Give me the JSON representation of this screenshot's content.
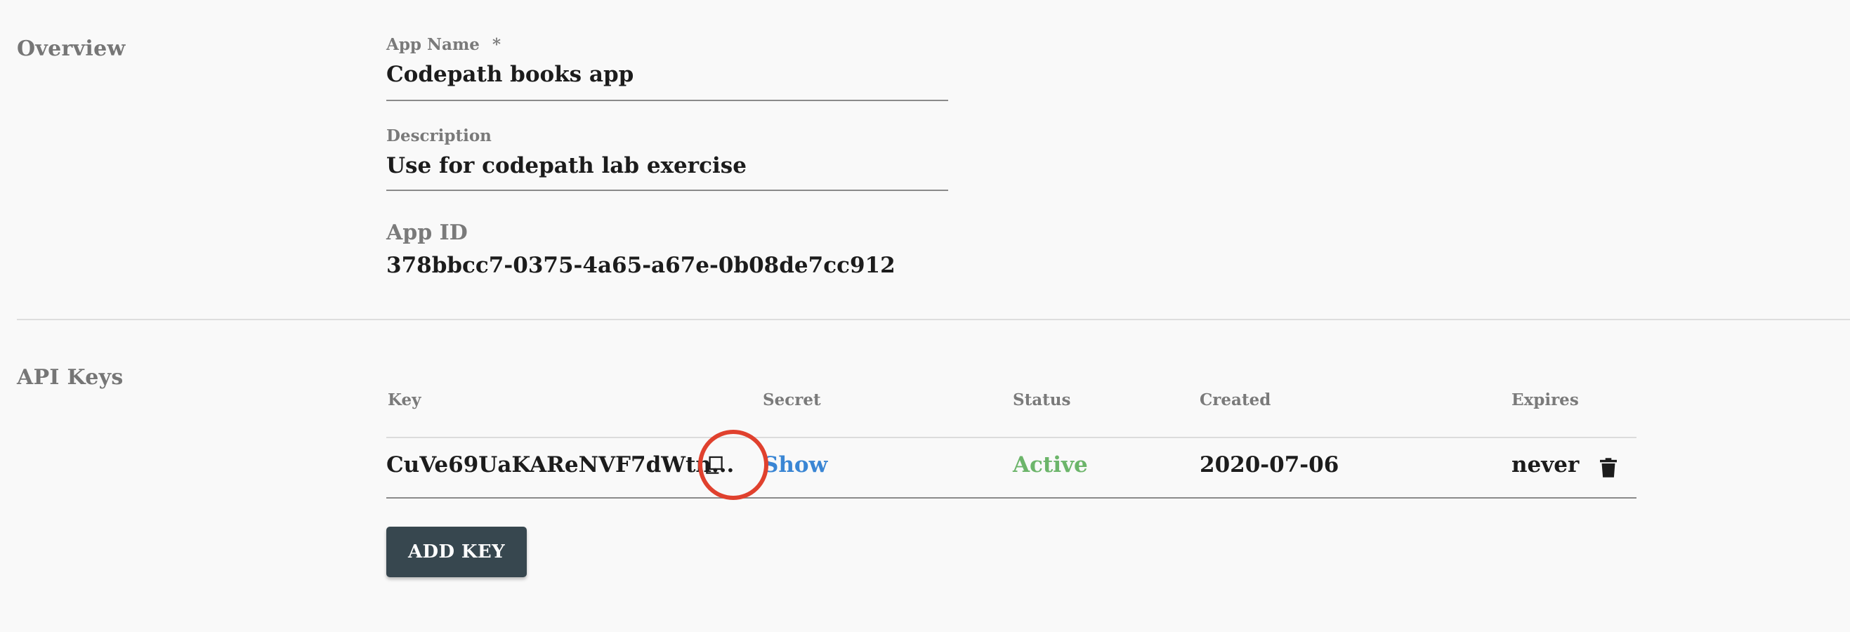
{
  "overview": {
    "section_title": "Overview",
    "app_name_label": "App Name",
    "required_mark": "*",
    "app_name_value": "Codepath books app",
    "description_label": "Description",
    "description_value": "Use for codepath lab exercise",
    "app_id_label": "App ID",
    "app_id_value": "378bbcc7-0375-4a65-a67e-0b08de7cc912"
  },
  "api_keys": {
    "section_title": "API Keys",
    "columns": {
      "key": "Key",
      "secret": "Secret",
      "status": "Status",
      "created": "Created",
      "expires": "Expires"
    },
    "rows": [
      {
        "key": "CuVe69UaKAReNVF7dWtn...",
        "secret_action": "Show",
        "status": "Active",
        "created": "2020-07-06",
        "expires": "never"
      }
    ],
    "add_key_label": "ADD KEY"
  },
  "colors": {
    "accent_link": "#3a86d4",
    "status_active": "#6cb56a",
    "button_bg": "#37474f",
    "highlight_ring": "#e0412e"
  },
  "icons": {
    "copy": "copy-icon",
    "delete": "trash-icon"
  }
}
